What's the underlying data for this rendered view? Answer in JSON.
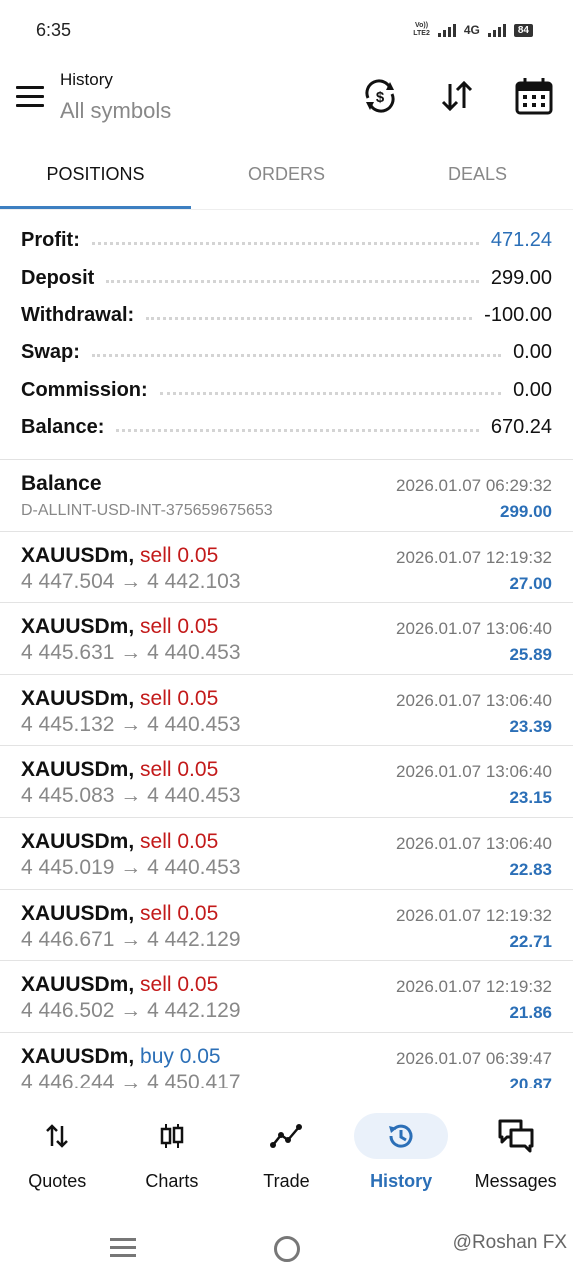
{
  "status_bar": {
    "time": "6:35",
    "volte": "Vo)) LTE2",
    "network": "4G",
    "battery": "84"
  },
  "app_bar": {
    "title": "History",
    "subtitle": "All symbols",
    "icons": [
      "menu-icon",
      "currency-refresh-icon",
      "sort-icon",
      "calendar-icon"
    ]
  },
  "tabs": [
    {
      "label": "POSITIONS",
      "active": true
    },
    {
      "label": "ORDERS",
      "active": false
    },
    {
      "label": "DEALS",
      "active": false
    }
  ],
  "summary": [
    {
      "label": "Profit:",
      "value": "471.24",
      "color": "#2b6fb7"
    },
    {
      "label": "Deposit",
      "value": "299.00"
    },
    {
      "label": "Withdrawal:",
      "value": "-100.00"
    },
    {
      "label": "Swap:",
      "value": "0.00"
    },
    {
      "label": "Commission:",
      "value": "0.00"
    },
    {
      "label": "Balance:",
      "value": "670.24"
    }
  ],
  "deals": [
    {
      "symbol": "Balance",
      "action": "",
      "line2": "D-ALLINT-USD-INT-375659675653",
      "time": "2026.01.07 06:29:32",
      "profit": "299.00"
    },
    {
      "symbol": "XAUUSDm,",
      "action": "sell 0.05",
      "side": "sell",
      "line2": "4 447.504 → 4 442.103",
      "time": "2026.01.07 12:19:32",
      "profit": "27.00"
    },
    {
      "symbol": "XAUUSDm,",
      "action": "sell 0.05",
      "side": "sell",
      "line2": "4 445.631 → 4 440.453",
      "time": "2026.01.07 13:06:40",
      "profit": "25.89"
    },
    {
      "symbol": "XAUUSDm,",
      "action": "sell 0.05",
      "side": "sell",
      "line2": "4 445.132 → 4 440.453",
      "time": "2026.01.07 13:06:40",
      "profit": "23.39"
    },
    {
      "symbol": "XAUUSDm,",
      "action": "sell 0.05",
      "side": "sell",
      "line2": "4 445.083 → 4 440.453",
      "time": "2026.01.07 13:06:40",
      "profit": "23.15"
    },
    {
      "symbol": "XAUUSDm,",
      "action": "sell 0.05",
      "side": "sell",
      "line2": "4 445.019 → 4 440.453",
      "time": "2026.01.07 13:06:40",
      "profit": "22.83"
    },
    {
      "symbol": "XAUUSDm,",
      "action": "sell 0.05",
      "side": "sell",
      "line2": "4 446.671 → 4 442.129",
      "time": "2026.01.07 12:19:32",
      "profit": "22.71"
    },
    {
      "symbol": "XAUUSDm,",
      "action": "sell 0.05",
      "side": "sell",
      "line2": "4 446.502 → 4 442.129",
      "time": "2026.01.07 12:19:32",
      "profit": "21.86"
    },
    {
      "symbol": "XAUUSDm,",
      "action": "buy 0.05",
      "side": "buy",
      "line2": "4 446.244 → 4 450.417",
      "time": "2026.01.07 06:39:47",
      "profit": "20.87"
    }
  ],
  "bottom_nav": [
    {
      "label": "Quotes",
      "icon": "quotes-arrows-icon",
      "active": false
    },
    {
      "label": "Charts",
      "icon": "candlestick-icon",
      "active": false
    },
    {
      "label": "Trade",
      "icon": "trade-line-icon",
      "active": false
    },
    {
      "label": "History",
      "icon": "history-clock-icon",
      "active": true
    },
    {
      "label": "Messages",
      "icon": "messages-icon",
      "active": false
    }
  ],
  "watermark": "@Roshan FX",
  "colors": {
    "accent": "#2b6fb7",
    "sell": "#c31a1a",
    "tab_indicator": "#3d7fc1"
  }
}
